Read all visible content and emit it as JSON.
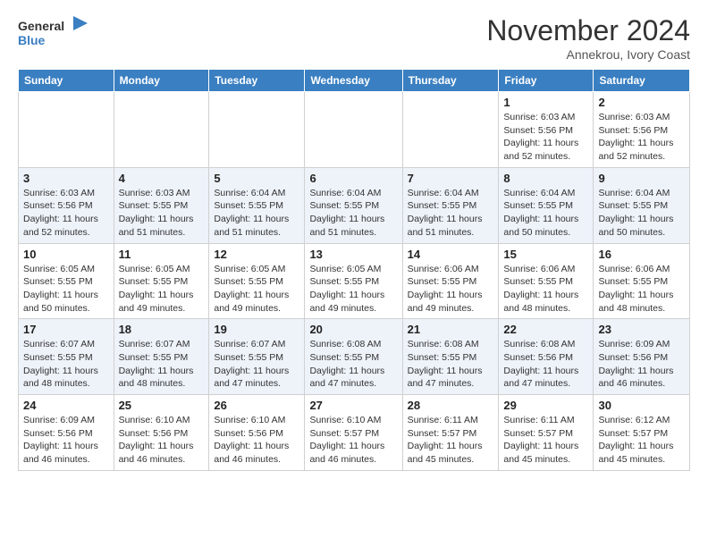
{
  "header": {
    "logo_line1": "General",
    "logo_line2": "Blue",
    "month_title": "November 2024",
    "location": "Annekrou, Ivory Coast"
  },
  "days_of_week": [
    "Sunday",
    "Monday",
    "Tuesday",
    "Wednesday",
    "Thursday",
    "Friday",
    "Saturday"
  ],
  "weeks": [
    [
      {
        "day": "",
        "info": ""
      },
      {
        "day": "",
        "info": ""
      },
      {
        "day": "",
        "info": ""
      },
      {
        "day": "",
        "info": ""
      },
      {
        "day": "",
        "info": ""
      },
      {
        "day": "1",
        "info": "Sunrise: 6:03 AM\nSunset: 5:56 PM\nDaylight: 11 hours and 52 minutes."
      },
      {
        "day": "2",
        "info": "Sunrise: 6:03 AM\nSunset: 5:56 PM\nDaylight: 11 hours and 52 minutes."
      }
    ],
    [
      {
        "day": "3",
        "info": "Sunrise: 6:03 AM\nSunset: 5:56 PM\nDaylight: 11 hours and 52 minutes."
      },
      {
        "day": "4",
        "info": "Sunrise: 6:03 AM\nSunset: 5:55 PM\nDaylight: 11 hours and 51 minutes."
      },
      {
        "day": "5",
        "info": "Sunrise: 6:04 AM\nSunset: 5:55 PM\nDaylight: 11 hours and 51 minutes."
      },
      {
        "day": "6",
        "info": "Sunrise: 6:04 AM\nSunset: 5:55 PM\nDaylight: 11 hours and 51 minutes."
      },
      {
        "day": "7",
        "info": "Sunrise: 6:04 AM\nSunset: 5:55 PM\nDaylight: 11 hours and 51 minutes."
      },
      {
        "day": "8",
        "info": "Sunrise: 6:04 AM\nSunset: 5:55 PM\nDaylight: 11 hours and 50 minutes."
      },
      {
        "day": "9",
        "info": "Sunrise: 6:04 AM\nSunset: 5:55 PM\nDaylight: 11 hours and 50 minutes."
      }
    ],
    [
      {
        "day": "10",
        "info": "Sunrise: 6:05 AM\nSunset: 5:55 PM\nDaylight: 11 hours and 50 minutes."
      },
      {
        "day": "11",
        "info": "Sunrise: 6:05 AM\nSunset: 5:55 PM\nDaylight: 11 hours and 49 minutes."
      },
      {
        "day": "12",
        "info": "Sunrise: 6:05 AM\nSunset: 5:55 PM\nDaylight: 11 hours and 49 minutes."
      },
      {
        "day": "13",
        "info": "Sunrise: 6:05 AM\nSunset: 5:55 PM\nDaylight: 11 hours and 49 minutes."
      },
      {
        "day": "14",
        "info": "Sunrise: 6:06 AM\nSunset: 5:55 PM\nDaylight: 11 hours and 49 minutes."
      },
      {
        "day": "15",
        "info": "Sunrise: 6:06 AM\nSunset: 5:55 PM\nDaylight: 11 hours and 48 minutes."
      },
      {
        "day": "16",
        "info": "Sunrise: 6:06 AM\nSunset: 5:55 PM\nDaylight: 11 hours and 48 minutes."
      }
    ],
    [
      {
        "day": "17",
        "info": "Sunrise: 6:07 AM\nSunset: 5:55 PM\nDaylight: 11 hours and 48 minutes."
      },
      {
        "day": "18",
        "info": "Sunrise: 6:07 AM\nSunset: 5:55 PM\nDaylight: 11 hours and 48 minutes."
      },
      {
        "day": "19",
        "info": "Sunrise: 6:07 AM\nSunset: 5:55 PM\nDaylight: 11 hours and 47 minutes."
      },
      {
        "day": "20",
        "info": "Sunrise: 6:08 AM\nSunset: 5:55 PM\nDaylight: 11 hours and 47 minutes."
      },
      {
        "day": "21",
        "info": "Sunrise: 6:08 AM\nSunset: 5:55 PM\nDaylight: 11 hours and 47 minutes."
      },
      {
        "day": "22",
        "info": "Sunrise: 6:08 AM\nSunset: 5:56 PM\nDaylight: 11 hours and 47 minutes."
      },
      {
        "day": "23",
        "info": "Sunrise: 6:09 AM\nSunset: 5:56 PM\nDaylight: 11 hours and 46 minutes."
      }
    ],
    [
      {
        "day": "24",
        "info": "Sunrise: 6:09 AM\nSunset: 5:56 PM\nDaylight: 11 hours and 46 minutes."
      },
      {
        "day": "25",
        "info": "Sunrise: 6:10 AM\nSunset: 5:56 PM\nDaylight: 11 hours and 46 minutes."
      },
      {
        "day": "26",
        "info": "Sunrise: 6:10 AM\nSunset: 5:56 PM\nDaylight: 11 hours and 46 minutes."
      },
      {
        "day": "27",
        "info": "Sunrise: 6:10 AM\nSunset: 5:57 PM\nDaylight: 11 hours and 46 minutes."
      },
      {
        "day": "28",
        "info": "Sunrise: 6:11 AM\nSunset: 5:57 PM\nDaylight: 11 hours and 45 minutes."
      },
      {
        "day": "29",
        "info": "Sunrise: 6:11 AM\nSunset: 5:57 PM\nDaylight: 11 hours and 45 minutes."
      },
      {
        "day": "30",
        "info": "Sunrise: 6:12 AM\nSunset: 5:57 PM\nDaylight: 11 hours and 45 minutes."
      }
    ]
  ]
}
